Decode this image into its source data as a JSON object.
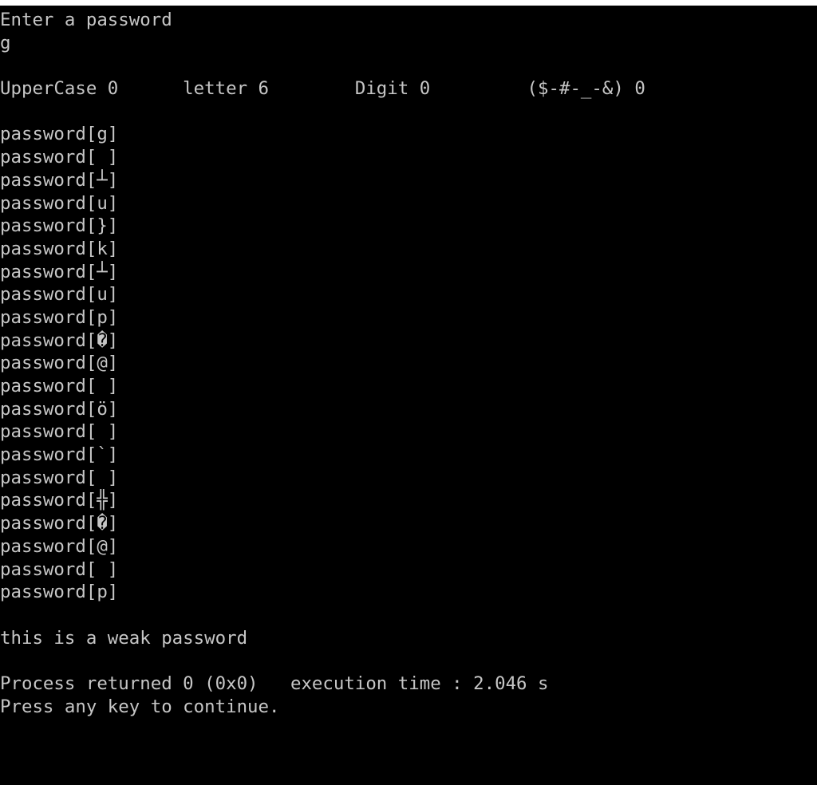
{
  "window": {
    "background_color": "#000000",
    "text_color": "#c6c6c6",
    "title_strip_color": "#ffffff"
  },
  "console": {
    "prompt_line": "Enter a password",
    "typed_input": "g",
    "blank_1": "",
    "stats": {
      "uppercase_label": "UpperCase",
      "uppercase_value": "0",
      "letter_label": "letter",
      "letter_value": "6",
      "digit_label": "Digit",
      "digit_value": "0",
      "special_label": "($-#-_-&)",
      "special_value": "0",
      "full_line": "UpperCase 0      letter 6        Digit 0         ($-#-_-&) 0"
    },
    "blank_2": "",
    "password_lines": [
      "password[g]",
      "password[ ]",
      "password[┴]",
      "password[u]",
      "password[}]",
      "password[k]",
      "password[┴]",
      "password[u]",
      "password[p]",
      "password[�]",
      "password[@]",
      "password[ ]",
      "password[ö]",
      "password[ ]",
      "password[`]",
      "password[ ]",
      "password[╬]",
      "password[�]",
      "password[@]",
      "password[ ]",
      "password[p]"
    ],
    "blank_3": "",
    "verdict": "this is a weak password",
    "blank_4": "",
    "process_returned": "Process returned 0 (0x0)   execution time : 2.046 s",
    "press_any_key": "Press any key to continue."
  }
}
